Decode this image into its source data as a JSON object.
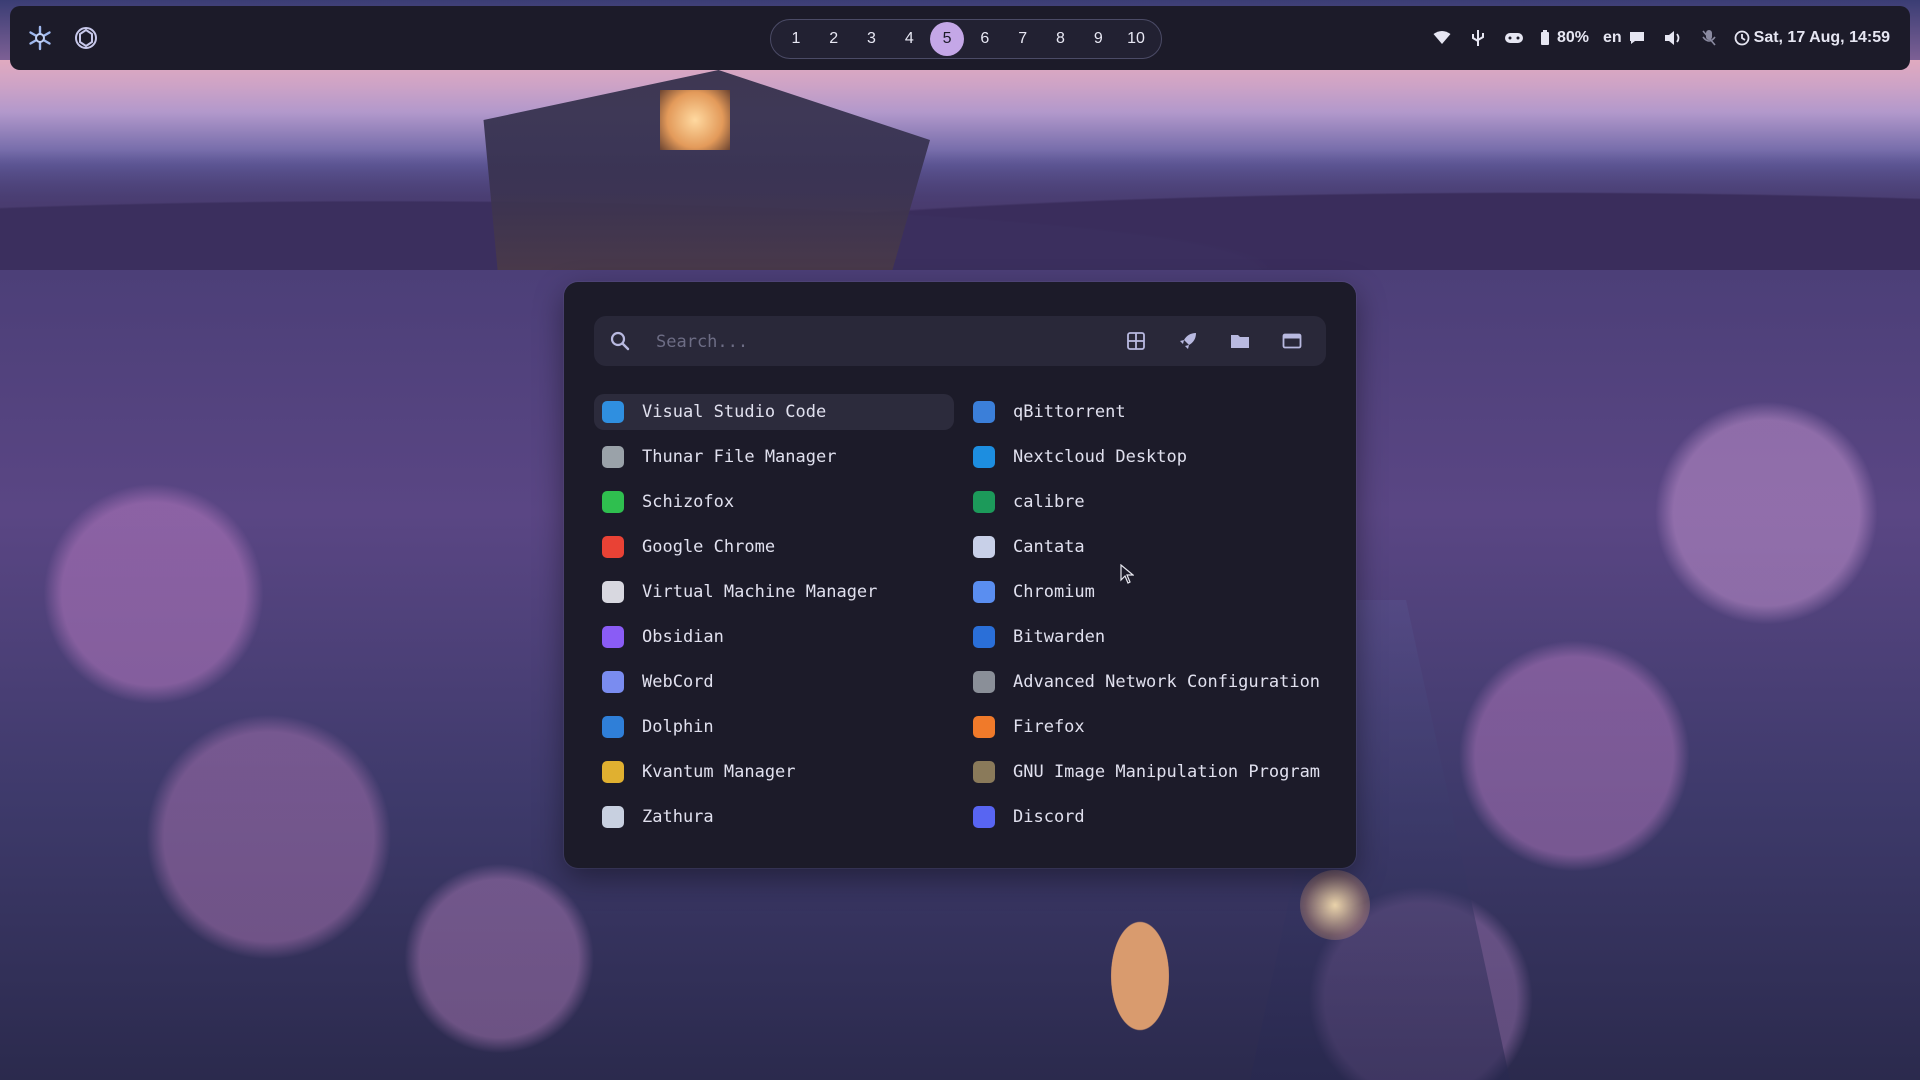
{
  "topbar": {
    "left_icons": [
      "nixos-snowflake-icon",
      "chatgpt-icon"
    ],
    "workspaces": [
      "1",
      "2",
      "3",
      "4",
      "5",
      "6",
      "7",
      "8",
      "9",
      "10"
    ],
    "active_workspace": "5",
    "status": {
      "battery": "80%",
      "keyboard_layout": "en",
      "datetime": "Sat, 17 Aug, 14:59",
      "icons": [
        "wifi-icon",
        "usb-icon",
        "gamepad-icon",
        "battery-icon",
        "notification-icon",
        "volume-icon",
        "microphone-muted-icon",
        "clock-icon"
      ]
    }
  },
  "launcher": {
    "search_placeholder": "Search...",
    "mode_icons": [
      "grid-icon",
      "rocket-icon",
      "folder-icon",
      "window-icon"
    ],
    "left_column": [
      {
        "label": "Visual Studio Code",
        "icon": "vscode-icon",
        "color": "#2f8fe0",
        "selected": true
      },
      {
        "label": "Thunar File Manager",
        "icon": "thunar-icon",
        "color": "#9aa2a9"
      },
      {
        "label": "Schizofox",
        "icon": "schizofox-icon",
        "color": "#2fbf4f"
      },
      {
        "label": "Google Chrome",
        "icon": "chrome-icon",
        "color": "#e94235"
      },
      {
        "label": "Virtual Machine Manager",
        "icon": "virt-manager-icon",
        "color": "#d8d8e0"
      },
      {
        "label": "Obsidian",
        "icon": "obsidian-icon",
        "color": "#8a5cf5"
      },
      {
        "label": "WebCord",
        "icon": "webcord-icon",
        "color": "#7a8cf0"
      },
      {
        "label": "Dolphin",
        "icon": "dolphin-icon",
        "color": "#2f7fd8"
      },
      {
        "label": "Kvantum Manager",
        "icon": "kvantum-icon",
        "color": "#e0b030"
      },
      {
        "label": "Zathura",
        "icon": "zathura-icon",
        "color": "#c8d0e0"
      }
    ],
    "right_column": [
      {
        "label": "qBittorrent",
        "icon": "qbittorrent-icon",
        "color": "#3b7fd9"
      },
      {
        "label": "Nextcloud Desktop",
        "icon": "nextcloud-icon",
        "color": "#1d8ee0"
      },
      {
        "label": "calibre",
        "icon": "calibre-icon",
        "color": "#1c9a5a"
      },
      {
        "label": "Cantata",
        "icon": "cantata-icon",
        "color": "#c8d0e8"
      },
      {
        "label": "Chromium",
        "icon": "chromium-icon",
        "color": "#5a8ef0"
      },
      {
        "label": "Bitwarden",
        "icon": "bitwarden-icon",
        "color": "#2a6fd8"
      },
      {
        "label": "Advanced Network Configuration",
        "icon": "network-config-icon",
        "color": "#8a8f98"
      },
      {
        "label": "Firefox",
        "icon": "firefox-icon",
        "color": "#f07a2a"
      },
      {
        "label": "GNU Image Manipulation Program",
        "icon": "gimp-icon",
        "color": "#8a7a5a"
      },
      {
        "label": "Discord",
        "icon": "discord-icon",
        "color": "#5865f2"
      }
    ]
  },
  "colors": {
    "bar_bg": "#1c1b29",
    "workspace_active": "#c4a7e7",
    "launcher_bg": "#1c1b29",
    "search_bg": "#292839",
    "selected_bg": "#2c2b3c"
  }
}
